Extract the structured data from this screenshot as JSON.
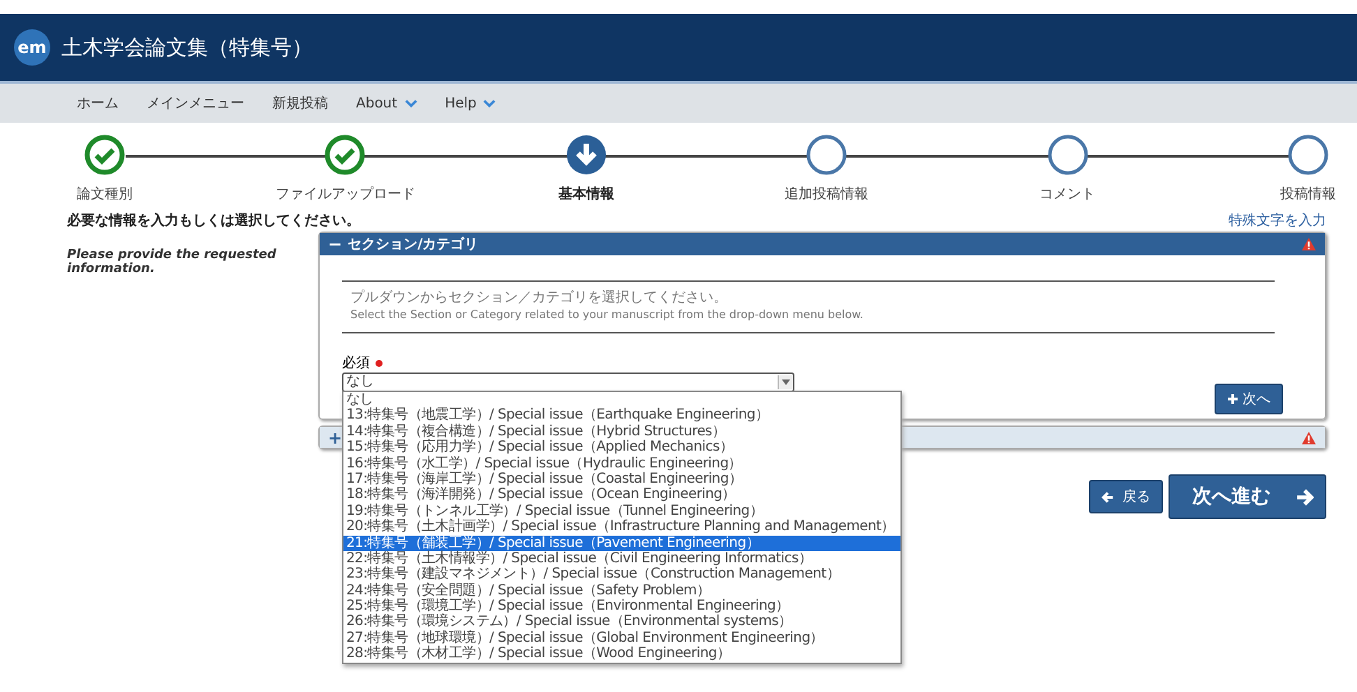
{
  "header": {
    "logo": "em",
    "title": "土木学会論文集（特集号）"
  },
  "nav": [
    {
      "label": "ホーム",
      "has_menu": false
    },
    {
      "label": "メインメニュー",
      "has_menu": false
    },
    {
      "label": "新規投稿",
      "has_menu": false
    },
    {
      "label": "About",
      "has_menu": true
    },
    {
      "label": "Help",
      "has_menu": true
    }
  ],
  "steps": [
    {
      "label": "論文種別",
      "kind": "done"
    },
    {
      "label": "ファイルアップロード",
      "kind": "done"
    },
    {
      "label": "基本情報",
      "kind": "current"
    },
    {
      "label": "追加投稿情報",
      "kind": "pending"
    },
    {
      "label": "コメント",
      "kind": "pending"
    },
    {
      "label": "投稿情報",
      "kind": "pending"
    }
  ],
  "instructions": {
    "ja": "必要な情報を入力もしくは選択してください。",
    "en": "Please provide the requested information."
  },
  "special_chars_link": "特殊文字を入力",
  "panels": [
    {
      "toggle": "−",
      "title": "セクション/カテゴリ",
      "expanded": true,
      "warning": true,
      "intro_ja": "プルダウンからセクション／カテゴリを選択してください。",
      "intro_en": "Select the Section or Category related to your manuscript from the drop-down menu below.",
      "field_label": "必須",
      "required": true,
      "value": "なし",
      "next_button": "次へ"
    },
    {
      "toggle": "+",
      "expanded": false,
      "warning": true
    }
  ],
  "dropdown_options": [
    {
      "label": "なし",
      "selected": false
    },
    {
      "label": "13:特集号（地震工学）/ Special issue（Earthquake Engineering）",
      "selected": false
    },
    {
      "label": "14:特集号（複合構造）/ Special issue（Hybrid Structures）",
      "selected": false
    },
    {
      "label": "15:特集号（応用力学）/ Special issue（Applied Mechanics）",
      "selected": false
    },
    {
      "label": "16:特集号（水工学）/ Special issue（Hydraulic Engineering）",
      "selected": false
    },
    {
      "label": "17:特集号（海岸工学）/ Special issue（Coastal Engineering）",
      "selected": false
    },
    {
      "label": "18:特集号（海洋開発）/ Special issue（Ocean Engineering）",
      "selected": false
    },
    {
      "label": "19:特集号（トンネル工学）/ Special issue（Tunnel Engineering）",
      "selected": false
    },
    {
      "label": "20:特集号（土木計画学）/ Special issue（Infrastructure Planning and Management）",
      "selected": false
    },
    {
      "label": "21:特集号（舗装工学）/ Special issue（Pavement Engineering）",
      "selected": true
    },
    {
      "label": "22:特集号（土木情報学）/ Special issue（Civil Engineering Informatics）",
      "selected": false
    },
    {
      "label": "23:特集号（建設マネジメント）/ Special issue（Construction Management）",
      "selected": false
    },
    {
      "label": "24:特集号（安全問題）/ Special issue（Safety Problem）",
      "selected": false
    },
    {
      "label": "25:特集号（環境工学）/ Special issue（Environmental Engineering）",
      "selected": false
    },
    {
      "label": "26:特集号（環境システム）/ Special issue（Environmental systems）",
      "selected": false
    },
    {
      "label": "27:特集号（地球環境）/ Special issue（Global Environment Engineering）",
      "selected": false
    },
    {
      "label": "28:特集号（木材工学）/ Special issue（Wood Engineering）",
      "selected": false
    }
  ],
  "buttons": {
    "back": "戻る",
    "next": "次へ進む"
  }
}
